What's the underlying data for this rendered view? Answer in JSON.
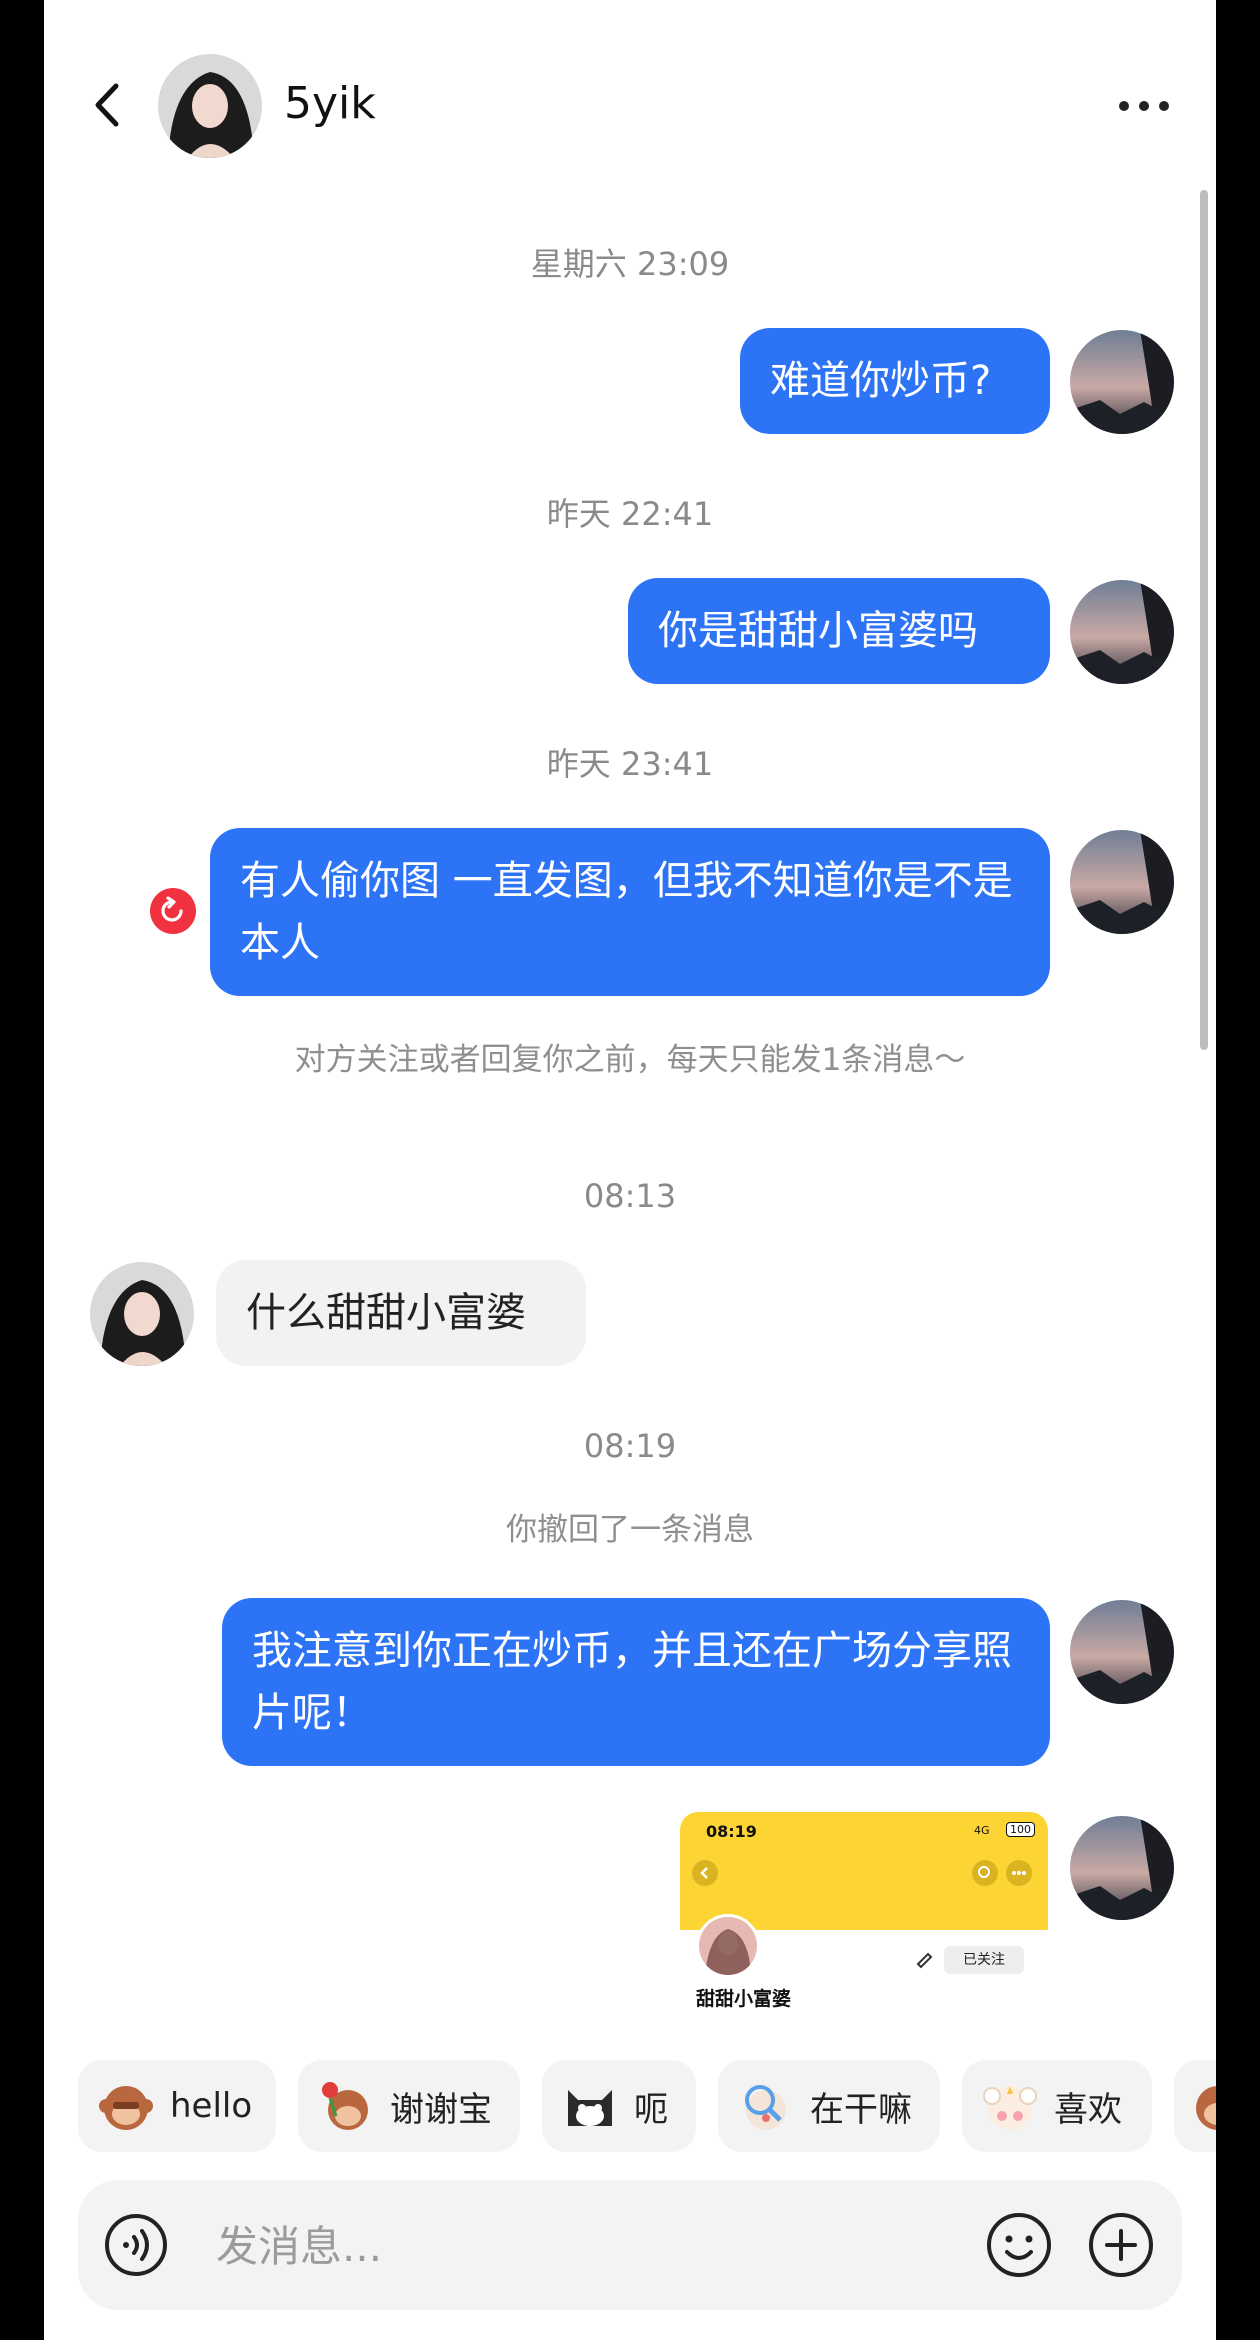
{
  "header": {
    "contact_name": "5yik"
  },
  "timestamps": {
    "t1": "星期六 23:09",
    "t2": "昨天 22:41",
    "t3": "昨天 23:41",
    "t4": "08:13",
    "t5": "08:19"
  },
  "messages": {
    "m1": "难道你炒币?",
    "m2": "你是甜甜小富婆吗",
    "m3": "有人偷你图 一直发图，但我不知道你是不是本人",
    "m4": "什么甜甜小富婆",
    "m5": "我注意到你正在炒币，并且还在广场分享照片呢！"
  },
  "notices": {
    "limit": "对方关注或者回复你之前，每天只能发1条消息～",
    "recalled": "你撤回了一条消息"
  },
  "image_card": {
    "time": "08:19",
    "follow_label": "已关注",
    "profile_name": "甜甜小富婆",
    "signal": "4G",
    "battery": "100"
  },
  "quick_replies": [
    {
      "label": "hello",
      "icon": "monkey-sticker-icon"
    },
    {
      "label": "谢谢宝",
      "icon": "monkey-rose-sticker-icon"
    },
    {
      "label": "呃",
      "icon": "cat-sticker-icon"
    },
    {
      "label": "在干嘛",
      "icon": "magnifier-sticker-icon"
    },
    {
      "label": "喜欢",
      "icon": "sheep-sticker-icon"
    }
  ],
  "input": {
    "placeholder": "发消息..."
  },
  "colors": {
    "bubble_out": "#2d73f5",
    "bubble_in": "#f2f2f2",
    "card_header": "#fcd535",
    "retry_badge": "#f0313f"
  }
}
